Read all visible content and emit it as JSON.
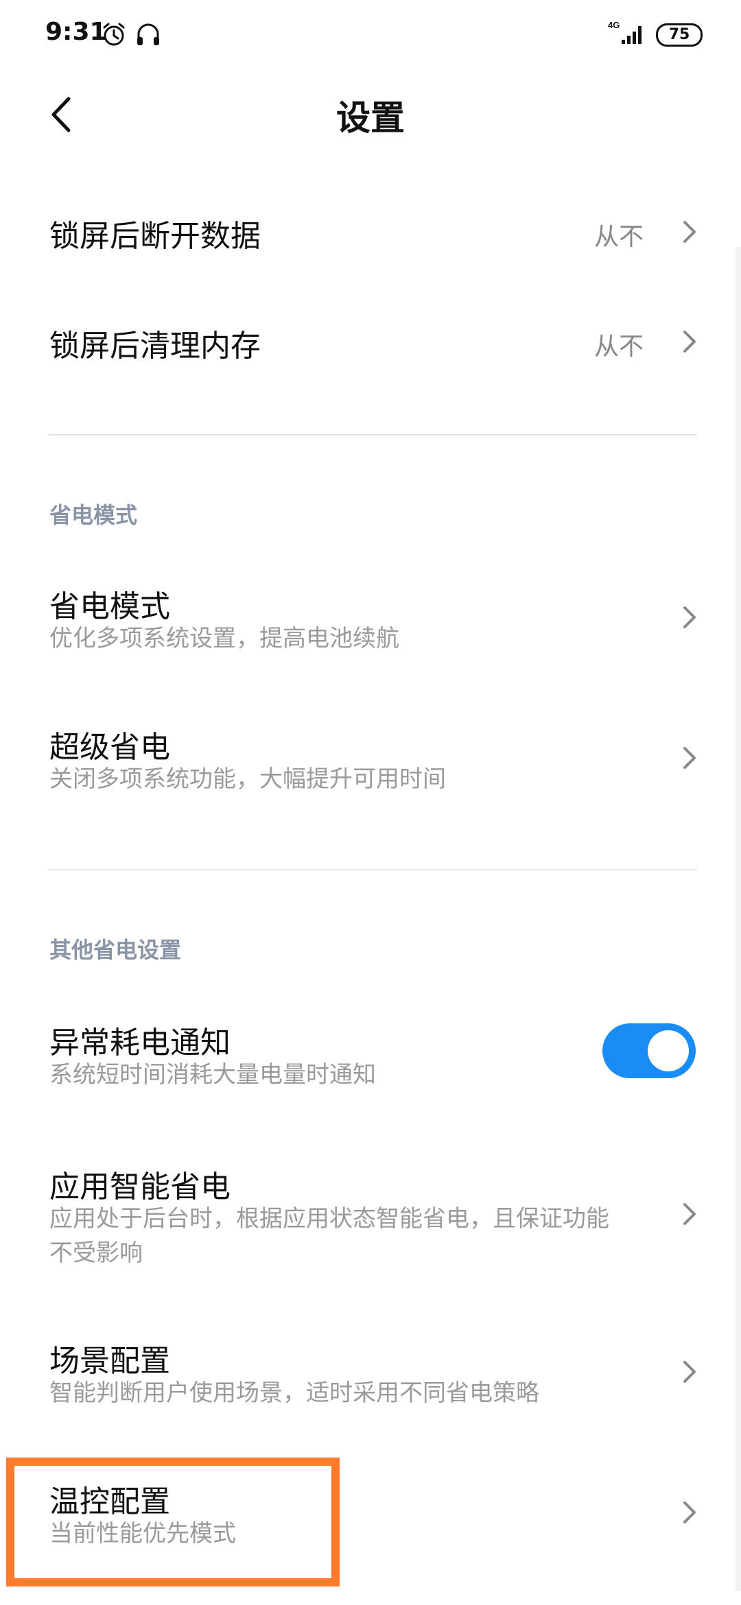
{
  "status_bar": {
    "time": "9:31",
    "network": "4G",
    "battery": "75",
    "icons": [
      "alarm-icon",
      "headset-icon",
      "signal-icon",
      "battery-icon"
    ]
  },
  "header": {
    "title": "设置",
    "back_icon": "back-arrow-icon"
  },
  "rows_top": [
    {
      "title": "锁屏后断开数据",
      "value": "从不"
    },
    {
      "title": "锁屏后清理内存",
      "value": "从不"
    }
  ],
  "section_power": {
    "header": "省电模式",
    "items": [
      {
        "title": "省电模式",
        "subtitle": "优化多项系统设置，提高电池续航"
      },
      {
        "title": "超级省电",
        "subtitle": "关闭多项系统功能，大幅提升可用时间"
      }
    ]
  },
  "section_other": {
    "header": "其他省电设置",
    "items": [
      {
        "title": "异常耗电通知",
        "subtitle": "系统短时间消耗大量电量时通知",
        "toggle": "on"
      },
      {
        "title": "应用智能省电",
        "subtitle": "应用处于后台时，根据应用状态智能省电，且保证功能不受影响"
      },
      {
        "title": "场景配置",
        "subtitle": "智能判断用户使用场景，适时采用不同省电策略"
      },
      {
        "title": "温控配置",
        "subtitle": "当前性能优先模式"
      }
    ]
  },
  "colors": {
    "accent": "#1a8cf5",
    "highlight": "#ff7a2a",
    "section_header": "#8a94a6"
  }
}
